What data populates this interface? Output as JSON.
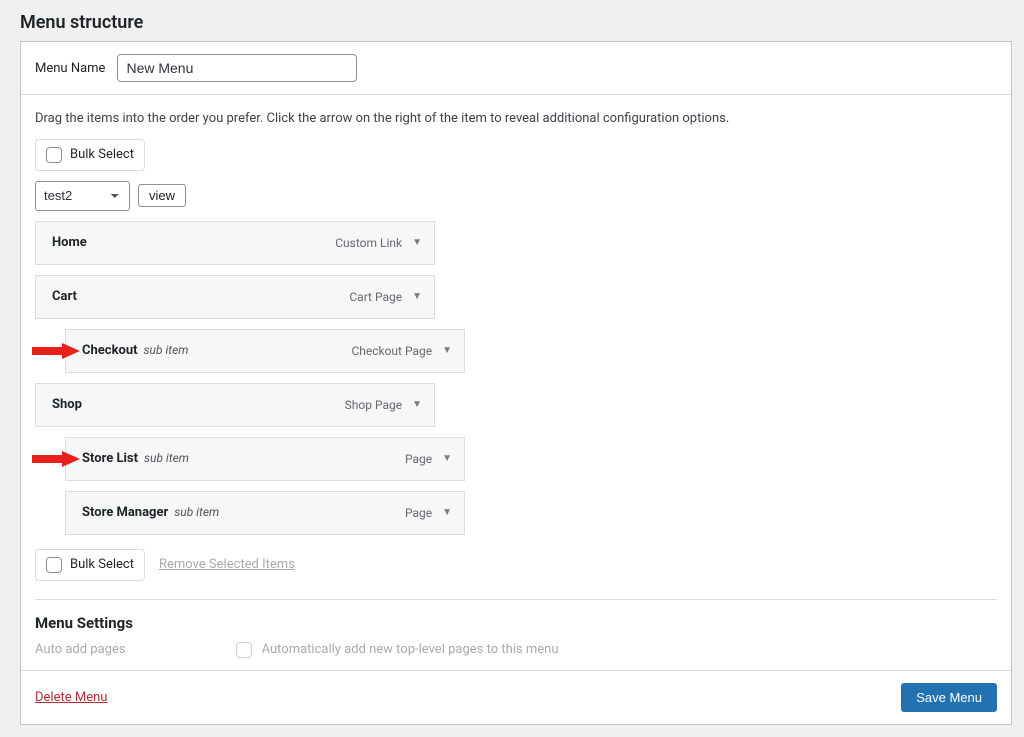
{
  "page": {
    "title": "Menu structure",
    "menu_name_label": "Menu Name",
    "menu_name_value": "New Menu",
    "instructions": "Drag the items into the order you prefer. Click the arrow on the right of the item to reveal additional configuration options.",
    "bulk_select_label": "Bulk Select",
    "dropdown_selected": "test2",
    "view_button": "view",
    "remove_selected_label": "Remove Selected Items",
    "menu_settings_title": "Menu Settings",
    "auto_add_label": "Auto add pages",
    "auto_add_desc": "Automatically add new top-level pages to this menu",
    "delete_menu_label": "Delete Menu",
    "save_menu_label": "Save Menu",
    "sub_item_text": "sub item"
  },
  "menu_items": [
    {
      "title": "Home",
      "type": "Custom Link",
      "depth": 0,
      "arrow": false
    },
    {
      "title": "Cart",
      "type": "Cart Page",
      "depth": 0,
      "arrow": false
    },
    {
      "title": "Checkout",
      "type": "Checkout Page",
      "depth": 1,
      "arrow": true
    },
    {
      "title": "Shop",
      "type": "Shop Page",
      "depth": 0,
      "arrow": false
    },
    {
      "title": "Store List",
      "type": "Page",
      "depth": 1,
      "arrow": true
    },
    {
      "title": "Store Manager",
      "type": "Page",
      "depth": 1,
      "arrow": false
    }
  ]
}
